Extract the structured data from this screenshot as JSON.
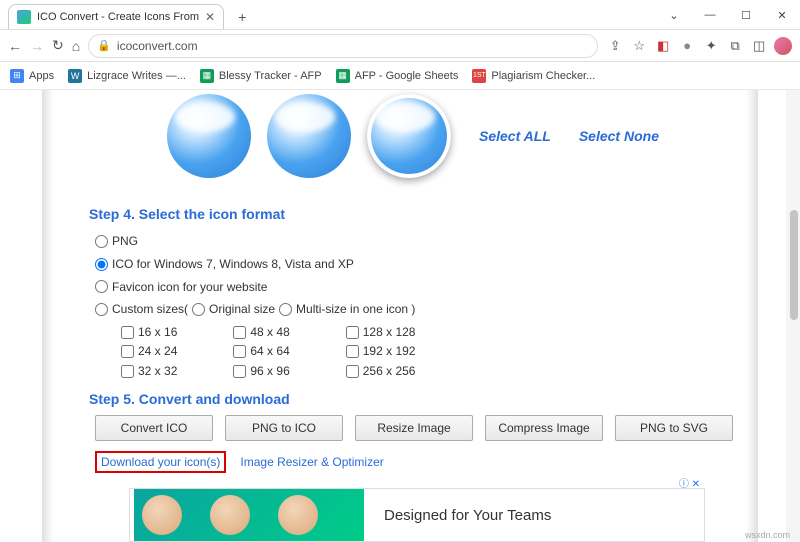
{
  "window": {
    "tab_title": "ICO Convert - Create Icons From",
    "min": "—",
    "max": "☐",
    "close": "✕",
    "dropdown": "⌄",
    "newtab": "+"
  },
  "toolbar": {
    "back": "←",
    "forward": "→",
    "reload": "↻",
    "home": "⌂",
    "lock": "🔒",
    "url": "icoconvert.com",
    "share": "⇪",
    "star": "☆",
    "ub": "◧",
    "dot": "●",
    "ext": "✦",
    "read": "⧉",
    "side": "◫",
    "menu": "⋮"
  },
  "bookmarks": {
    "apps": "Apps",
    "b1": "Lizgrace Writes —...",
    "b2": "Blessy Tracker - AFP",
    "b3": "AFP - Google Sheets",
    "b4": "Plagiarism Checker...",
    "b4icon": "1ST"
  },
  "clouds": {
    "select_all": "Select ALL",
    "select_none": "Select None"
  },
  "step4": {
    "title": "Step 4. Select the icon format",
    "opt_png": "PNG",
    "opt_ico": "ICO for Windows 7, Windows 8, Vista and XP",
    "opt_fav": "Favicon icon for your website",
    "opt_custom_pre": "Custom sizes( ",
    "opt_orig": "Original size ",
    "opt_multi": "Multi-size in one icon )",
    "sizes_a": [
      "16 x 16",
      "24 x 24",
      "32 x 32"
    ],
    "sizes_b": [
      "48 x 48",
      "64 x 64",
      "96 x 96"
    ],
    "sizes_c": [
      "128 x 128",
      "192 x 192",
      "256 x 256"
    ]
  },
  "step5": {
    "title": "Step 5. Convert and download",
    "btn1": "Convert ICO",
    "btn2": "PNG to ICO",
    "btn3": "Resize Image",
    "btn4": "Compress Image",
    "btn5": "PNG to SVG",
    "download": "Download your icon(s)",
    "optimizer": "Image Resizer & Optimizer"
  },
  "ad": {
    "close": "ⓘ ✕",
    "text": "Designed for Your Teams"
  },
  "watermark": "wsxdn.com"
}
